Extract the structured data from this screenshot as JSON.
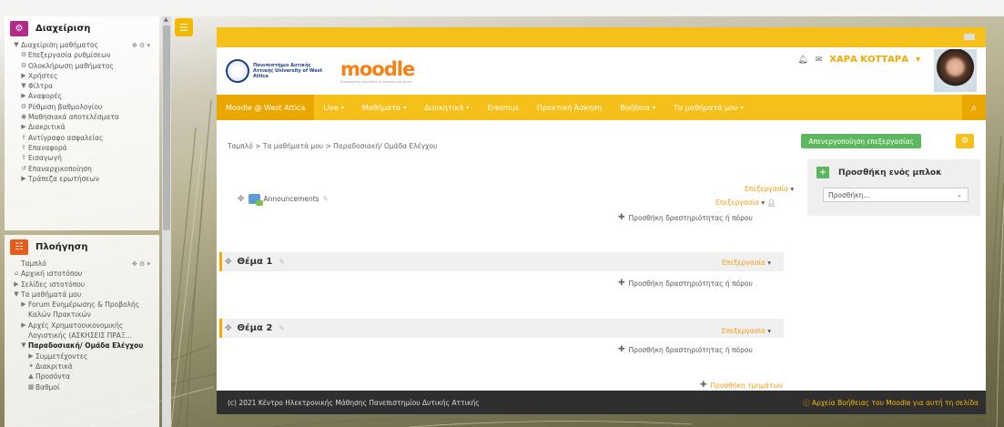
{
  "admin_block": {
    "title": "Διαχείριση",
    "controls": "✥ ⚙ ▾",
    "items": [
      {
        "label": "Διαχείριση μαθήματος",
        "icon": "expanded-arrow-icon"
      },
      {
        "label": "Επεξεργασία ρυθμίσεων",
        "icon": "gear-icon"
      },
      {
        "label": "Ολοκλήρωση μαθήματος",
        "icon": "gear-icon"
      },
      {
        "label": "Χρήστες",
        "icon": "collapsed-arrow-icon"
      },
      {
        "label": "Φίλτρα",
        "icon": "filter-icon"
      },
      {
        "label": "Αναφορές",
        "icon": "collapsed-arrow-icon"
      },
      {
        "label": "Ρύθμιση βαθμολογίου",
        "icon": "gear-icon"
      },
      {
        "label": "Μαθησιακά αποτελέσματα",
        "icon": "outcomes-icon"
      },
      {
        "label": "Διακριτικά",
        "icon": "collapsed-arrow-icon"
      },
      {
        "label": "Αντίγραφο ασφαλείας",
        "icon": "upload-icon"
      },
      {
        "label": "Επαναφορά",
        "icon": "upload-icon"
      },
      {
        "label": "Εισαγωγή",
        "icon": "upload-icon"
      },
      {
        "label": "Επαναρχικοποίηση",
        "icon": "reset-icon"
      },
      {
        "label": "Τράπεζα ερωτήσεων",
        "icon": "collapsed-arrow-icon"
      }
    ]
  },
  "nav_block": {
    "title": "Πλοήγηση",
    "controls": "✥ ⚙ ▾",
    "items": [
      {
        "label": "Ταμπλό",
        "icon": ""
      },
      {
        "label": "Αρχική ιστοτόπου",
        "icon": "home-icon"
      },
      {
        "label": "Σελίδες ιστοτόπου",
        "icon": "collapsed-arrow-icon"
      },
      {
        "label": "Τα μαθήματά μου",
        "icon": "expanded-arrow-icon"
      },
      {
        "label": "Forum Ενημέρωσης & Προβολής Καλών Πρακτικών",
        "icon": "collapsed-arrow-icon"
      },
      {
        "label": "Αρχές Χρηματοοικονομικής Λογιστικής (ΑΣΚΗΣΕΙΣ ΠΡΑΞ...",
        "icon": "collapsed-arrow-icon"
      },
      {
        "label": "Παραδοσιακή/ Ομάδα Ελέγχου",
        "icon": "expanded-arrow-icon"
      },
      {
        "label": "Συμμετέχοντες",
        "icon": "collapsed-arrow-icon"
      },
      {
        "label": "Διακριτικά",
        "icon": "badge-icon"
      },
      {
        "label": "Προσόντα",
        "icon": "competency-icon"
      },
      {
        "label": "Βαθμοί",
        "icon": "grades-icon"
      }
    ]
  },
  "header": {
    "university_text": "Πανεπιστήμιο Δυτικής Αττικής University of West Attica",
    "moodle_logo": "moodle",
    "moodle_tagline": "Empowering educators to improve our world",
    "user_name": "ΧΑΡΑ ΚΟΤΤΑΡΑ",
    "user_caret": "▾"
  },
  "navbar": {
    "items": [
      {
        "label": "Moodle @ West Attica",
        "caret": ""
      },
      {
        "label": "Live",
        "caret": "▾"
      },
      {
        "label": "Μαθήματα",
        "caret": "▾"
      },
      {
        "label": "Διοικητικά",
        "caret": "▾"
      },
      {
        "label": "Erasmus",
        "caret": ""
      },
      {
        "label": "Πρακτική Άσκηση",
        "caret": ""
      },
      {
        "label": "Βοήθεια",
        "caret": "▾"
      },
      {
        "label": "Τα μαθήματά μου",
        "caret": "▾"
      }
    ]
  },
  "content": {
    "breadcrumb": "Ταμπλό > Τα μαθήματά μου > Παραδοσιακή/ Ομάδα Ελέγχου",
    "edit_toggle": "Απενεργοποίηση επεξεργασίας",
    "edit_label": "Επεξεργασία",
    "edit_caret": "▾",
    "announcements": "Announcements",
    "add_activity": "Προσθήκη δραστηριότητας ή πόρου",
    "sections": [
      {
        "title": "Θέμα 1"
      },
      {
        "title": "Θέμα 2"
      }
    ],
    "add_sections": "Προσθήκη τμημάτων"
  },
  "add_block": {
    "title": "Προσθήκη ενός μπλοκ",
    "select_value": "Προσθήκη..."
  },
  "footer": {
    "copyright": "(c) 2021 Κέντρο Ηλεκτρονικής Μάθησης Πανεπιστημίου Δυτικής Αττικής",
    "help_link": "ⓘ Αρχεία Βοήθειας του Moodle για αυτή τη σελίδα"
  },
  "colors": {
    "brand_yellow": "#f6c01b",
    "edit_green": "#5cb85c",
    "link_orange": "#f39c12",
    "footer_dark": "#2f2f30",
    "admin_icon": "#b42a8b",
    "nav_icon": "#e65c1b"
  }
}
